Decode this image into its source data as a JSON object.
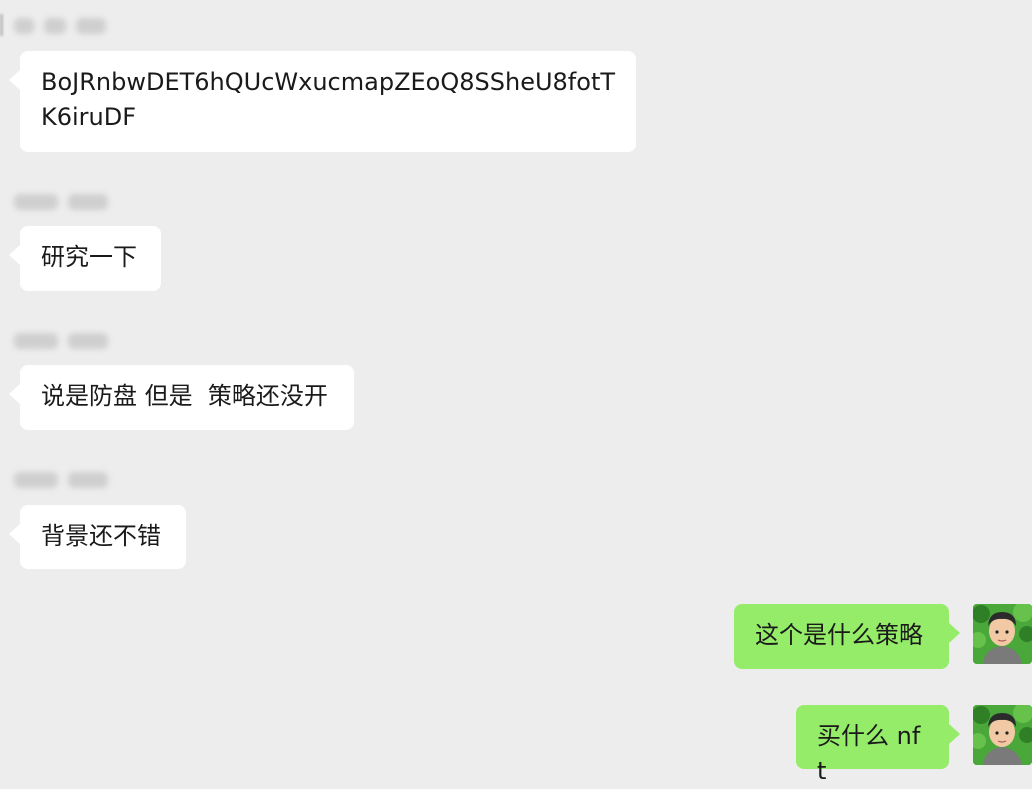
{
  "chat": {
    "messages": [
      {
        "direction": "incoming",
        "text": "BoJRnbwDET6hQUcWxucmapZEoQ8SSheU8fotTK6iruDF"
      },
      {
        "direction": "incoming",
        "text": "研究一下"
      },
      {
        "direction": "incoming",
        "text": "说是防盘 但是  策略还没开"
      },
      {
        "direction": "incoming",
        "text": "背景还不错"
      },
      {
        "direction": "outgoing",
        "text": "这个是什么策略"
      },
      {
        "direction": "outgoing",
        "text": "买什么 nft"
      }
    ]
  },
  "colors": {
    "background": "#ededed",
    "incoming_bubble": "#ffffff",
    "outgoing_bubble": "#95ec69",
    "text": "#1a1a1a"
  },
  "icons": {
    "avatar": "user-avatar-icon"
  }
}
